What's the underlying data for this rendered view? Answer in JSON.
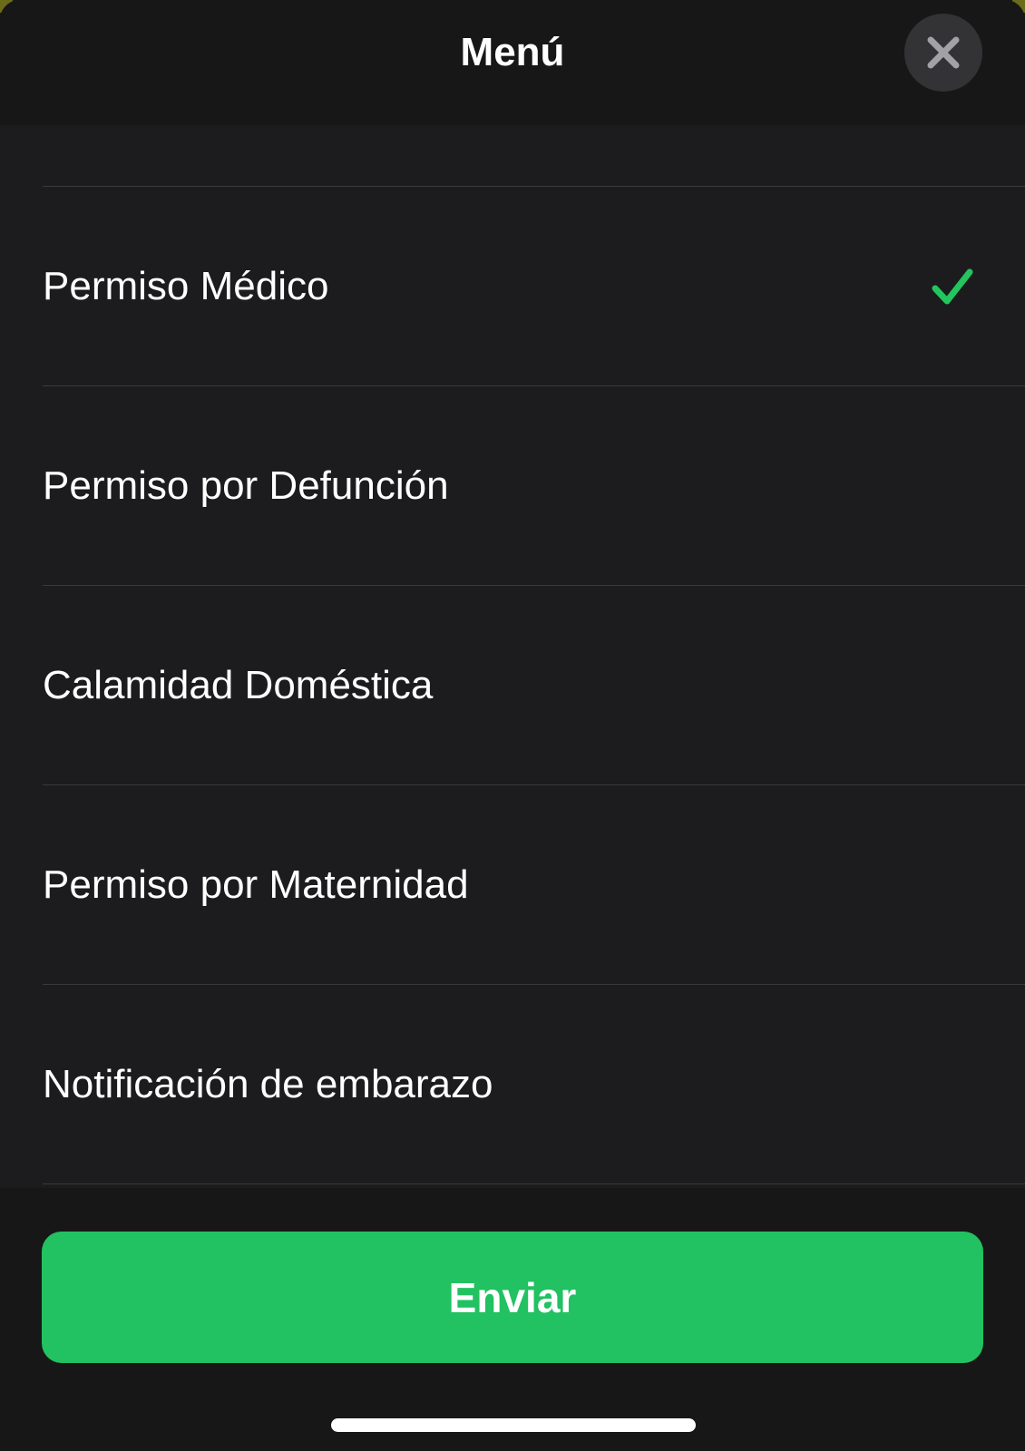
{
  "header": {
    "title": "Menú",
    "close_icon": "close-icon"
  },
  "menu": {
    "items": [
      {
        "label": "Permiso Médico",
        "selected": true
      },
      {
        "label": "Permiso por Defunción",
        "selected": false
      },
      {
        "label": "Calamidad Doméstica",
        "selected": false
      },
      {
        "label": "Permiso por Maternidad",
        "selected": false
      },
      {
        "label": "Notificación de embarazo",
        "selected": false
      }
    ],
    "check_icon": "checkmark-icon"
  },
  "footer": {
    "send_label": "Enviar"
  },
  "colors": {
    "accent_green": "#22c161",
    "check_green": "#22c55e",
    "background": "#1c1c1e",
    "header_background": "#171717"
  }
}
